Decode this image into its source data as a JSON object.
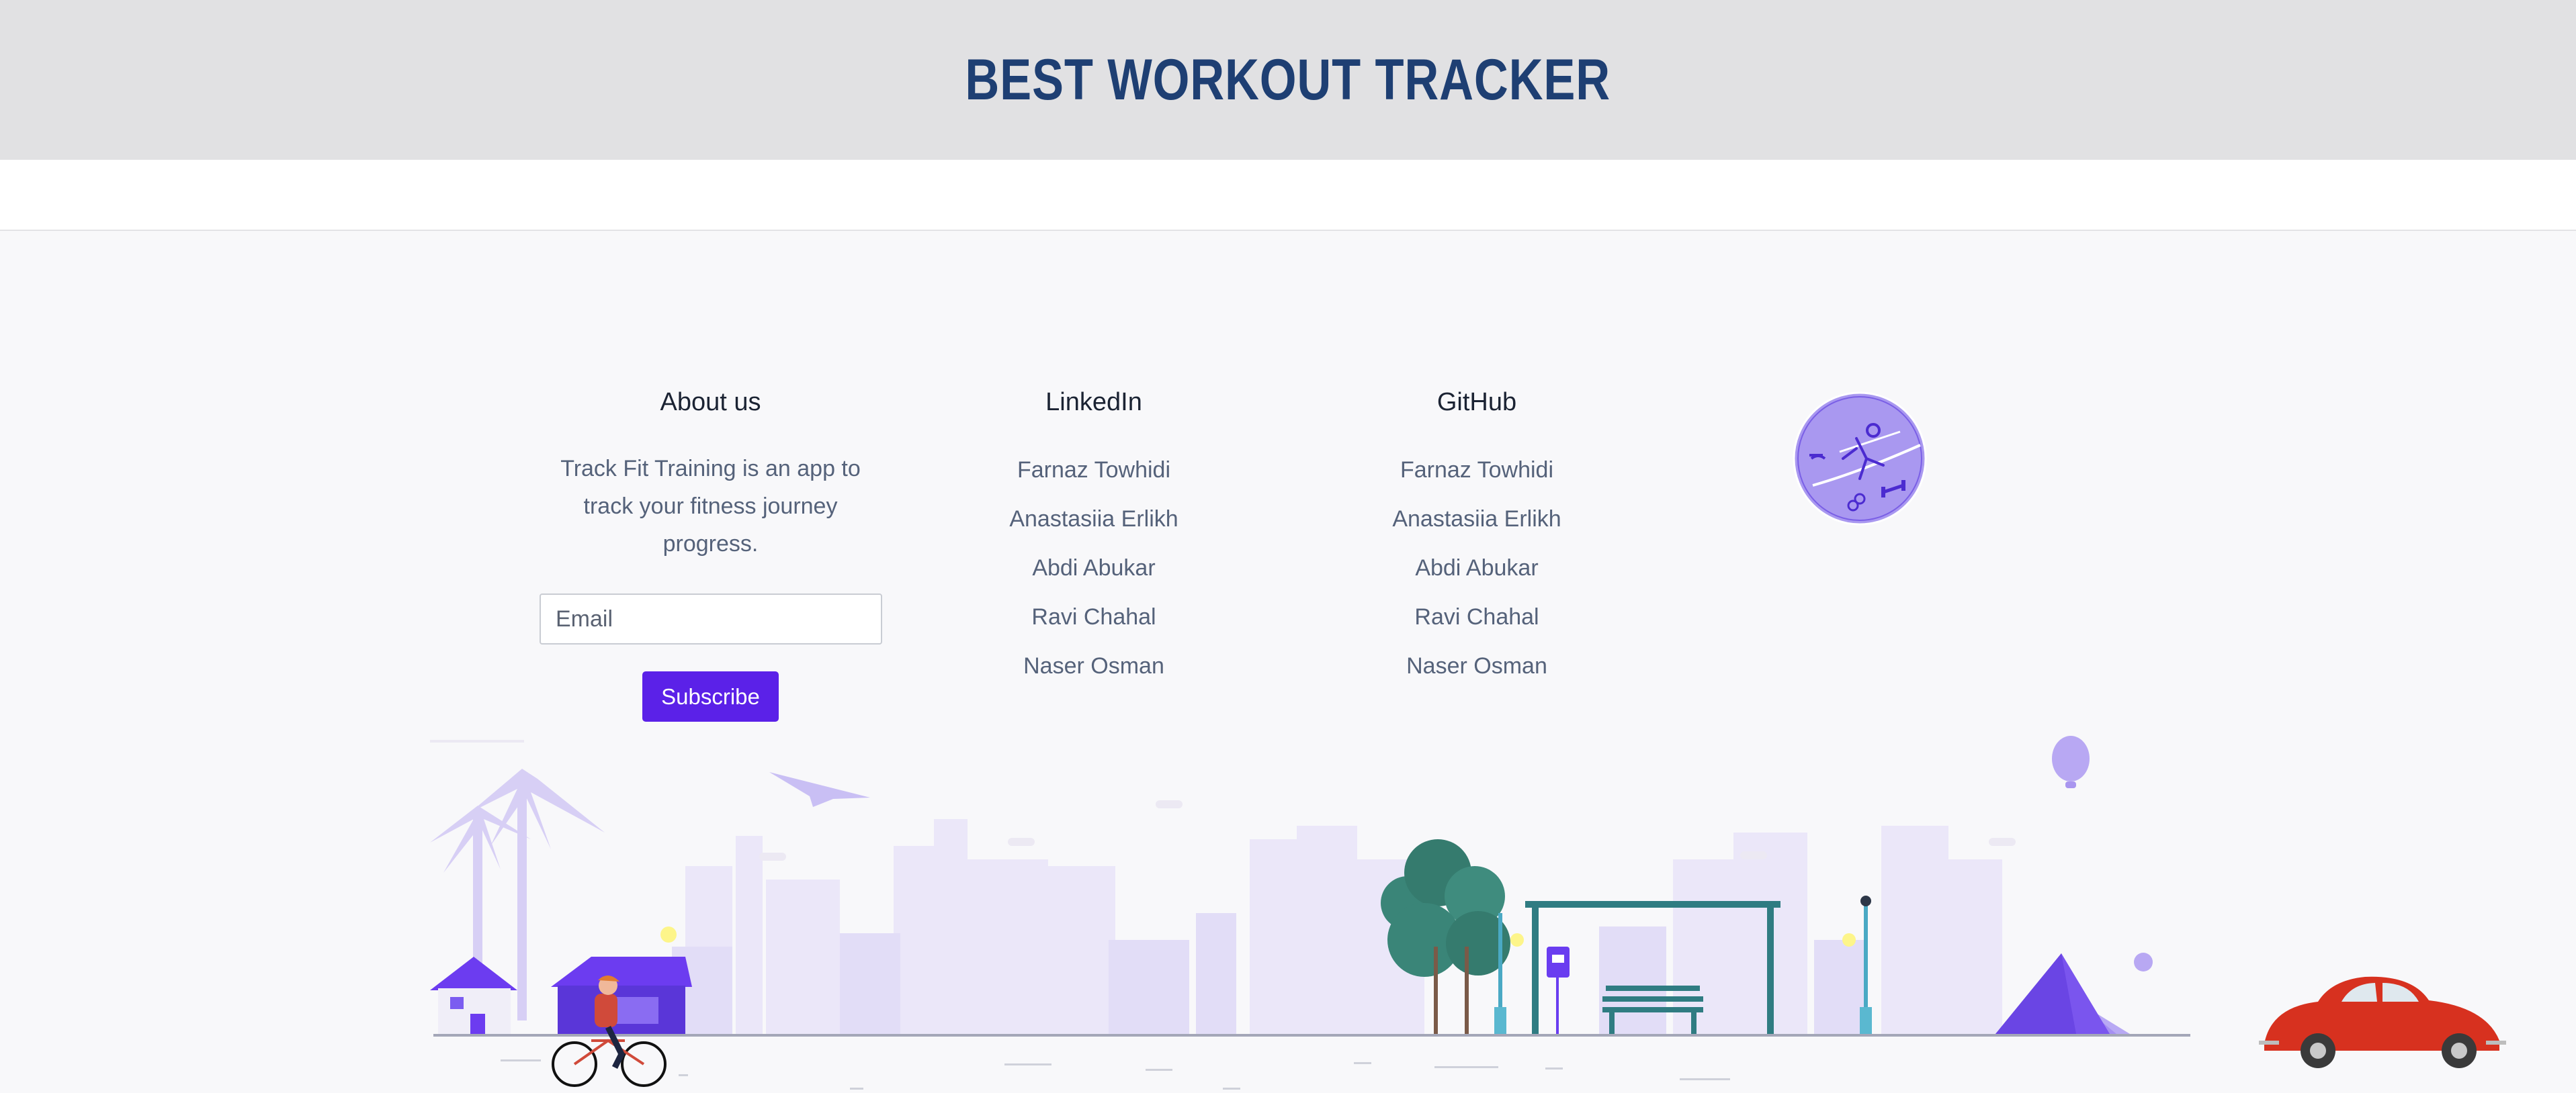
{
  "header": {
    "title": "BEST WORKOUT TRACKER"
  },
  "about": {
    "heading": "About us",
    "description": "Track Fit Training is an app to track your fitness journey progress.",
    "email_placeholder": "Email",
    "subscribe_label": "Subscribe"
  },
  "linkedin": {
    "heading": "LinkedIn",
    "items": [
      "Farnaz Towhidi",
      "Anastasiia Erlikh",
      "Abdi Abukar",
      "Ravi Chahal",
      "Naser Osman"
    ]
  },
  "github": {
    "heading": "GitHub",
    "items": [
      "Farnaz Towhidi",
      "Anastasiia Erlikh",
      "Abdi Abukar",
      "Ravi Chahal",
      "Naser Osman"
    ]
  },
  "colors": {
    "header_bg": "#e1e1e3",
    "title": "#1e3f73",
    "accent": "#5b21e8",
    "footer_bg": "#f8f8fa"
  },
  "icons": {
    "logo": "fitness-logo-icon",
    "illustration": "city-street-illustration"
  }
}
